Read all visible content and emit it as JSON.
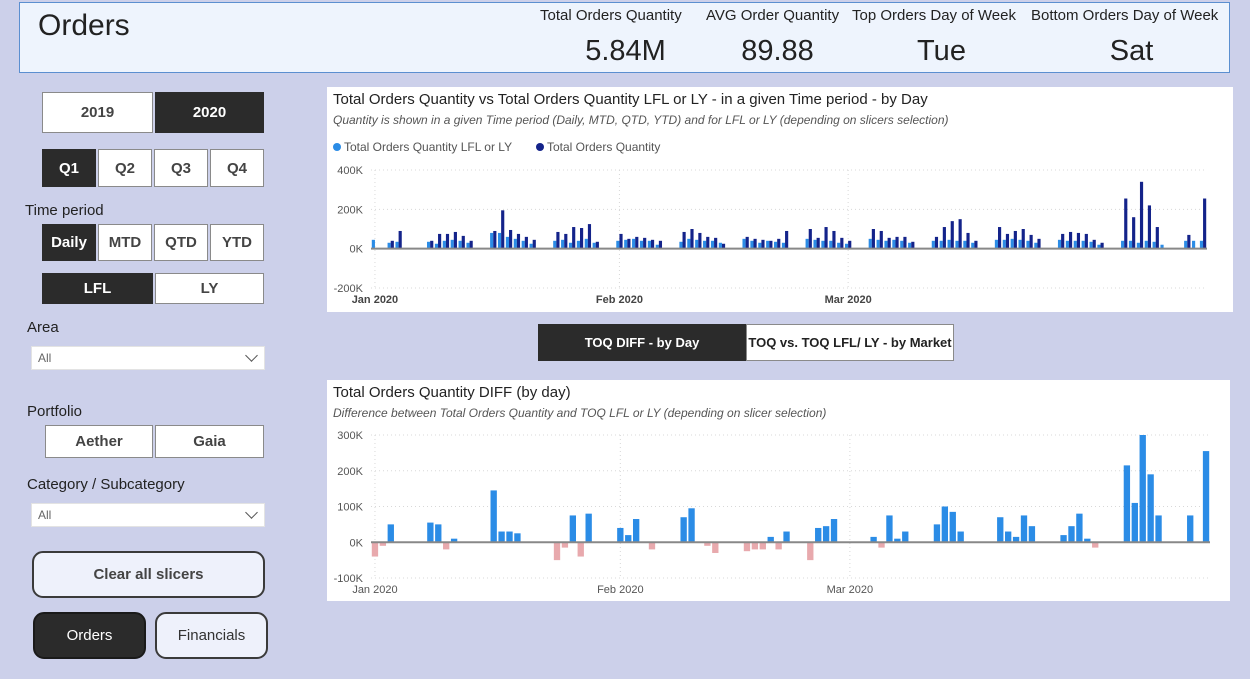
{
  "header": {
    "title": "Orders",
    "kpis": [
      {
        "label": "Total Orders Quantity",
        "value": "5.84M"
      },
      {
        "label": "AVG Order Quantity",
        "value": "89.88"
      },
      {
        "label": "Top Orders Day of Week",
        "value": "Tue"
      },
      {
        "label": "Bottom Orders Day of Week",
        "value": "Sat"
      }
    ]
  },
  "slicers": {
    "years": [
      {
        "label": "2019",
        "selected": false
      },
      {
        "label": "2020",
        "selected": true
      }
    ],
    "quarters": [
      {
        "label": "Q1",
        "selected": true
      },
      {
        "label": "Q2",
        "selected": false
      },
      {
        "label": "Q3",
        "selected": false
      },
      {
        "label": "Q4",
        "selected": false
      }
    ],
    "time_period_label": "Time period",
    "time_periods": [
      {
        "label": "Daily",
        "selected": true
      },
      {
        "label": "MTD",
        "selected": false
      },
      {
        "label": "QTD",
        "selected": false
      },
      {
        "label": "YTD",
        "selected": false
      }
    ],
    "comparison": [
      {
        "label": "LFL",
        "selected": true
      },
      {
        "label": "LY",
        "selected": false
      }
    ],
    "area_label": "Area",
    "area_value": "All",
    "portfolio_label": "Portfolio",
    "portfolios": [
      {
        "label": "Aether",
        "selected": false
      },
      {
        "label": "Gaia",
        "selected": false
      }
    ],
    "category_label": "Category / Subcategory",
    "category_value": "All",
    "clear_label": "Clear all slicers"
  },
  "nav": [
    {
      "label": "Orders",
      "selected": true
    },
    {
      "label": "Financials",
      "selected": false
    }
  ],
  "toggle": [
    {
      "label": "TOQ DIFF - by Day",
      "selected": true
    },
    {
      "label": "TOQ vs. TOQ LFL/ LY - by Market",
      "selected": false
    }
  ],
  "colors": {
    "lfl": "#2b8ce6",
    "current": "#14238a",
    "diff_pos": "#2b8ce6",
    "diff_neg": "#e8a9ad",
    "selected_bg": "#2b2b2b"
  },
  "chart_data": [
    {
      "type": "bar",
      "title": "Total Orders Quantity vs Total Orders Quantity LFL or LY - in a given Time period - by Day",
      "subtitle": "Quantity is shown in a given Time period (Daily, MTD, QTD, YTD) and for LFL or LY (depending on slicers selection)",
      "legend_position": "top-left",
      "y_ticks": [
        "400K",
        "200K",
        "0K",
        "-200K"
      ],
      "ylim": [
        -200000,
        400000
      ],
      "x_tick_labels": [
        "Jan 2020",
        "Feb 2020",
        "Mar 2020"
      ],
      "x_tick_days": [
        0,
        31,
        60
      ],
      "grid": true,
      "series": [
        {
          "name": "Total Orders Quantity LFL or LY",
          "values": [
            45000,
            0,
            30000,
            35000,
            0,
            0,
            0,
            35000,
            25000,
            40000,
            45000,
            40000,
            30000,
            0,
            0,
            80000,
            80000,
            60000,
            50000,
            40000,
            25000,
            0,
            0,
            40000,
            45000,
            30000,
            40000,
            50000,
            30000,
            0,
            0,
            40000,
            45000,
            50000,
            40000,
            40000,
            20000,
            0,
            0,
            35000,
            50000,
            45000,
            40000,
            40000,
            30000,
            0,
            0,
            50000,
            40000,
            30000,
            40000,
            35000,
            30000,
            0,
            0,
            50000,
            45000,
            40000,
            40000,
            30000,
            25000,
            0,
            0,
            50000,
            45000,
            40000,
            45000,
            40000,
            30000,
            0,
            0,
            40000,
            40000,
            45000,
            40000,
            40000,
            30000,
            0,
            0,
            45000,
            45000,
            50000,
            45000,
            40000,
            30000,
            0,
            0,
            45000,
            40000,
            40000,
            40000,
            35000,
            20000,
            0,
            0,
            40000,
            40000,
            30000,
            40000,
            35000,
            20000,
            0,
            0,
            40000,
            40000,
            40000
          ]
        },
        {
          "name": "Total Orders Quantity",
          "values": [
            0,
            0,
            40000,
            90000,
            0,
            0,
            0,
            40000,
            75000,
            75000,
            85000,
            65000,
            40000,
            0,
            0,
            90000,
            195000,
            95000,
            75000,
            60000,
            45000,
            0,
            0,
            85000,
            75000,
            110000,
            105000,
            125000,
            35000,
            0,
            0,
            75000,
            50000,
            60000,
            55000,
            45000,
            40000,
            0,
            0,
            85000,
            100000,
            80000,
            60000,
            55000,
            25000,
            0,
            0,
            60000,
            50000,
            45000,
            40000,
            50000,
            90000,
            0,
            0,
            100000,
            55000,
            110000,
            90000,
            55000,
            40000,
            0,
            0,
            100000,
            90000,
            55000,
            60000,
            60000,
            35000,
            0,
            0,
            60000,
            110000,
            140000,
            150000,
            80000,
            40000,
            0,
            0,
            110000,
            75000,
            90000,
            100000,
            70000,
            50000,
            0,
            0,
            75000,
            85000,
            80000,
            75000,
            45000,
            30000,
            0,
            0,
            255000,
            160000,
            340000,
            220000,
            110000,
            0,
            0,
            0,
            70000,
            0,
            255000
          ]
        }
      ]
    },
    {
      "type": "bar",
      "title": "Total Orders Quantity DIFF (by day)",
      "subtitle": "Difference between Total Orders Quantity and TOQ LFL or LY (depending on slicer selection)",
      "y_ticks": [
        "300K",
        "200K",
        "100K",
        "0K",
        "-100K"
      ],
      "ylim": [
        -100000,
        300000
      ],
      "x_tick_labels": [
        "Jan 2020",
        "Feb 2020",
        "Mar 2020"
      ],
      "x_tick_days": [
        0,
        31,
        60
      ],
      "grid": true,
      "series": [
        {
          "name": "",
          "values": [
            -40000,
            -10000,
            50000,
            0,
            0,
            0,
            0,
            55000,
            50000,
            -20000,
            10000,
            0,
            0,
            0,
            0,
            145000,
            30000,
            30000,
            25000,
            0,
            0,
            0,
            0,
            -50000,
            -15000,
            75000,
            -40000,
            80000,
            0,
            0,
            0,
            40000,
            20000,
            65000,
            0,
            -20000,
            0,
            0,
            0,
            70000,
            95000,
            0,
            -10000,
            -30000,
            0,
            0,
            0,
            -25000,
            -20000,
            -20000,
            15000,
            -20000,
            30000,
            0,
            0,
            -50000,
            40000,
            45000,
            65000,
            0,
            0,
            0,
            0,
            15000,
            -15000,
            75000,
            10000,
            30000,
            0,
            0,
            0,
            50000,
            100000,
            85000,
            30000,
            0,
            0,
            0,
            0,
            70000,
            30000,
            15000,
            75000,
            45000,
            0,
            0,
            0,
            20000,
            45000,
            80000,
            10000,
            -15000,
            0,
            0,
            0,
            215000,
            110000,
            300000,
            190000,
            75000,
            0,
            0,
            0,
            75000,
            0,
            255000
          ]
        }
      ]
    }
  ]
}
